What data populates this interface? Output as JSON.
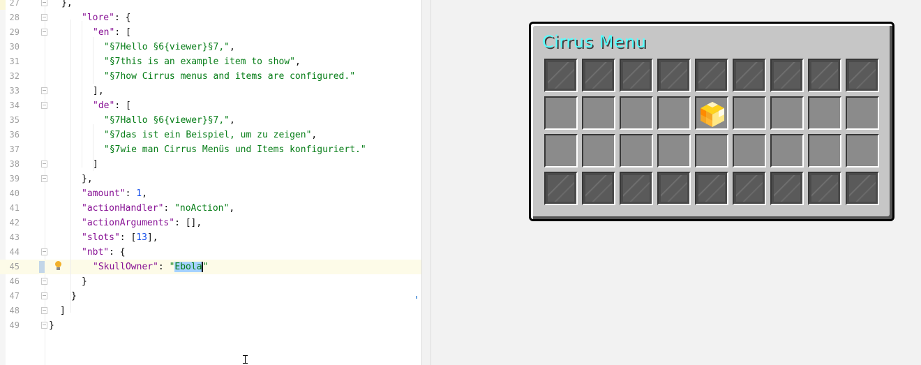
{
  "editor": {
    "first_line_number": 27,
    "current_line_number": 45,
    "lines": [
      [
        [
          "pun",
          "},"
        ]
      ],
      [
        [
          "key",
          "\"lore\""
        ],
        [
          "pun",
          ": {"
        ]
      ],
      [
        [
          "key",
          "\"en\""
        ],
        [
          "pun",
          ": ["
        ]
      ],
      [
        [
          "str",
          "\"§7Hello §6{viewer}§7,\""
        ],
        [
          "pun",
          ","
        ]
      ],
      [
        [
          "str",
          "\"§7this is an example item to show\""
        ],
        [
          "pun",
          ","
        ]
      ],
      [
        [
          "str",
          "\"§7how Cirrus menus and items are configured.\""
        ]
      ],
      [
        [
          "pun",
          "],"
        ]
      ],
      [
        [
          "key",
          "\"de\""
        ],
        [
          "pun",
          ": ["
        ]
      ],
      [
        [
          "str",
          "\"§7Hallo §6{viewer}§7,\""
        ],
        [
          "pun",
          ","
        ]
      ],
      [
        [
          "str",
          "\"§7das ist ein Beispiel, um zu zeigen\""
        ],
        [
          "pun",
          ","
        ]
      ],
      [
        [
          "str",
          "\"§7wie man Cirrus Menüs und Items konfiguriert.\""
        ]
      ],
      [
        [
          "pun",
          "]"
        ]
      ],
      [
        [
          "pun",
          "},"
        ]
      ],
      [
        [
          "key",
          "\"amount\""
        ],
        [
          "pun",
          ": "
        ],
        [
          "num",
          "1"
        ],
        [
          "pun",
          ","
        ]
      ],
      [
        [
          "key",
          "\"actionHandler\""
        ],
        [
          "pun",
          ": "
        ],
        [
          "str",
          "\"noAction\""
        ],
        [
          "pun",
          ","
        ]
      ],
      [
        [
          "key",
          "\"actionArguments\""
        ],
        [
          "pun",
          ": [],"
        ]
      ],
      [
        [
          "key",
          "\"slots\""
        ],
        [
          "pun",
          ": ["
        ],
        [
          "num",
          "13"
        ],
        [
          "pun",
          "],"
        ]
      ],
      [
        [
          "key",
          "\"nbt\""
        ],
        [
          "pun",
          ": {"
        ]
      ],
      [
        [
          "key",
          "\"SkullOwner\""
        ],
        [
          "pun",
          ": "
        ],
        [
          "str",
          "\""
        ],
        [
          "sel",
          "Ebola"
        ],
        [
          "caret",
          ""
        ],
        [
          "str",
          "\""
        ]
      ],
      [
        [
          "pun",
          "}"
        ]
      ],
      [
        [
          "pun",
          "}"
        ]
      ],
      [
        [
          "pun",
          "]"
        ]
      ],
      [
        [
          "pun",
          "}"
        ]
      ]
    ]
  },
  "preview": {
    "title": "Cirrus Menu",
    "title_color": "#55ffff",
    "rows": 4,
    "columns": 9,
    "glass_rows": [
      0,
      3
    ],
    "items": [
      {
        "slot": 13,
        "icon": "yellow-orange-head-block-icon",
        "name": "SkullOwner Ebola head"
      }
    ]
  },
  "colors": {
    "json_key": "#871094",
    "json_string": "#067d17",
    "json_number": "#1750eb",
    "selection": "#a6d2ff",
    "current_line": "#fdfbe8"
  }
}
